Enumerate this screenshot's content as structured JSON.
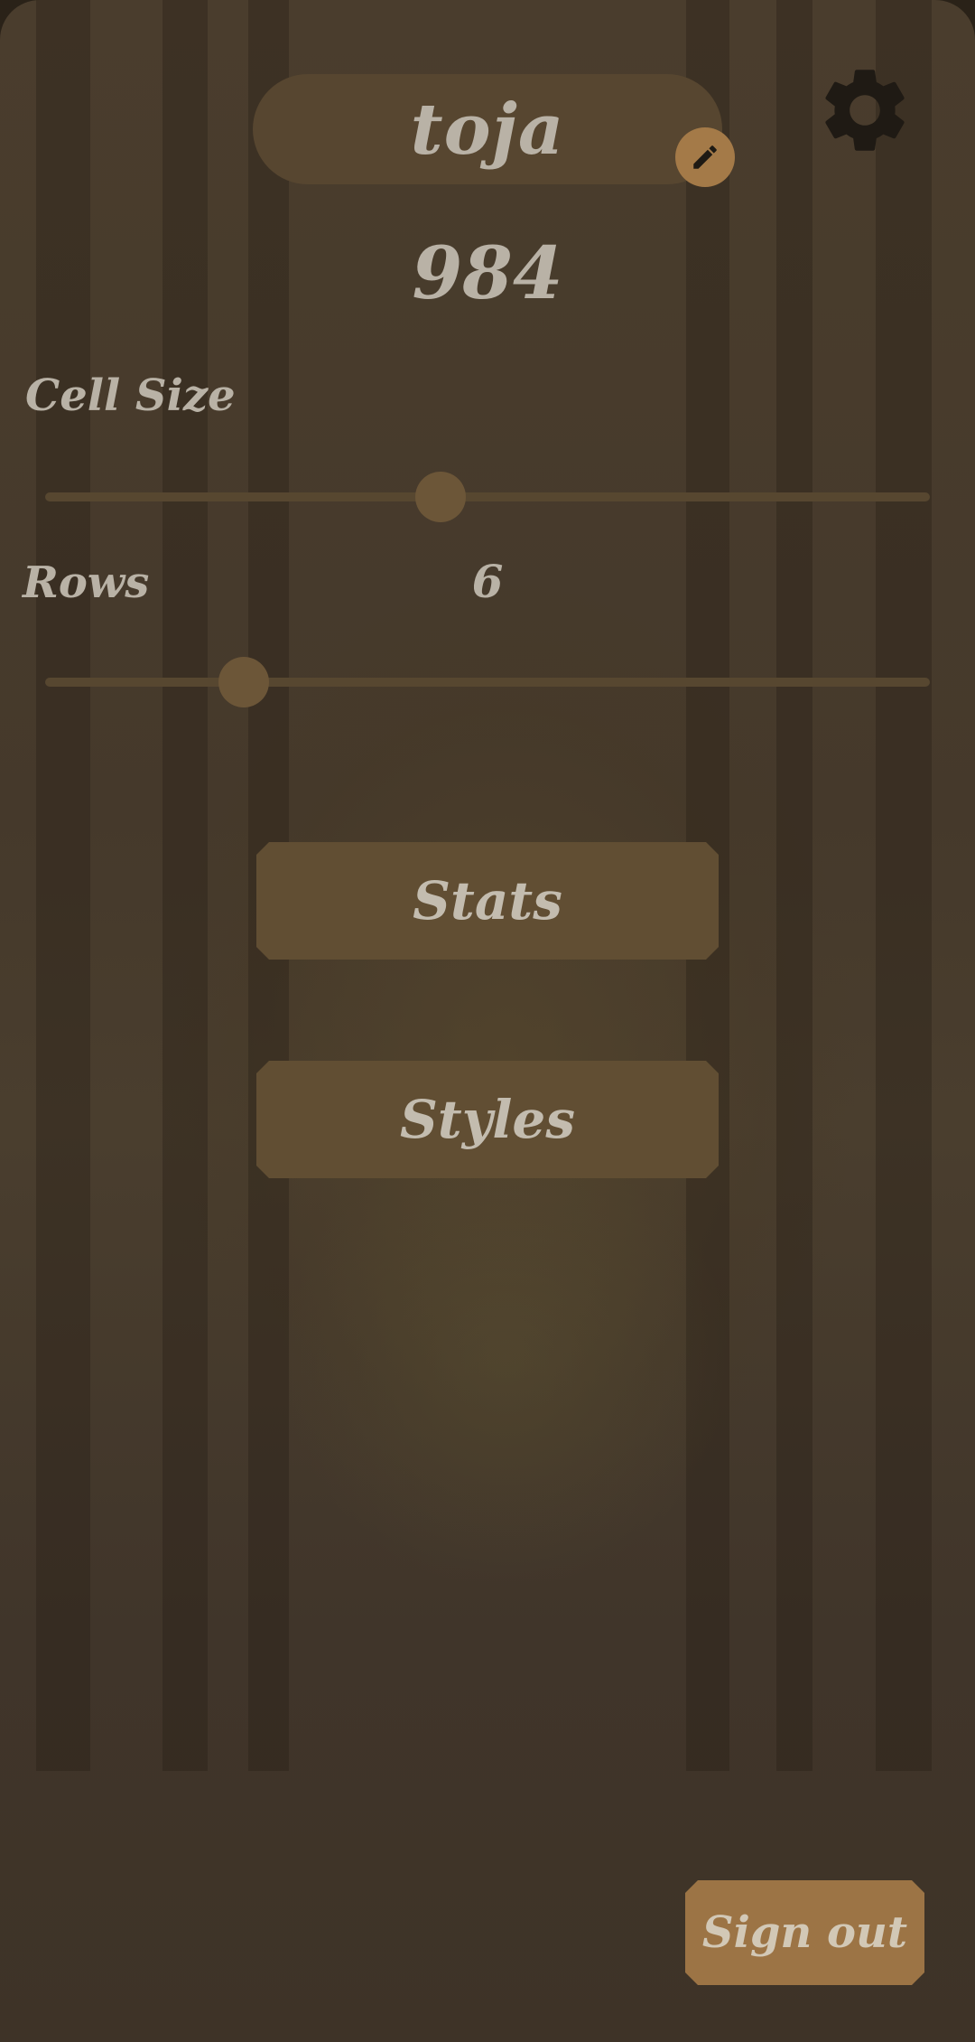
{
  "profile": {
    "username": "toja",
    "score": "984"
  },
  "icons": {
    "edit": "pencil-icon",
    "settings": "gear-icon"
  },
  "settings": {
    "cell_size_label": "Cell Size",
    "cell_size_level": 0.45,
    "rows_label": "Rows",
    "rows_value": "6",
    "rows_level": 0.23
  },
  "menu": {
    "stats_label": "Stats",
    "styles_label": "Styles"
  },
  "footer": {
    "sign_out_label": "Sign out"
  },
  "colors": {
    "accent": "#a47a48",
    "button": "#614e33",
    "text": "#b9b2a6"
  }
}
